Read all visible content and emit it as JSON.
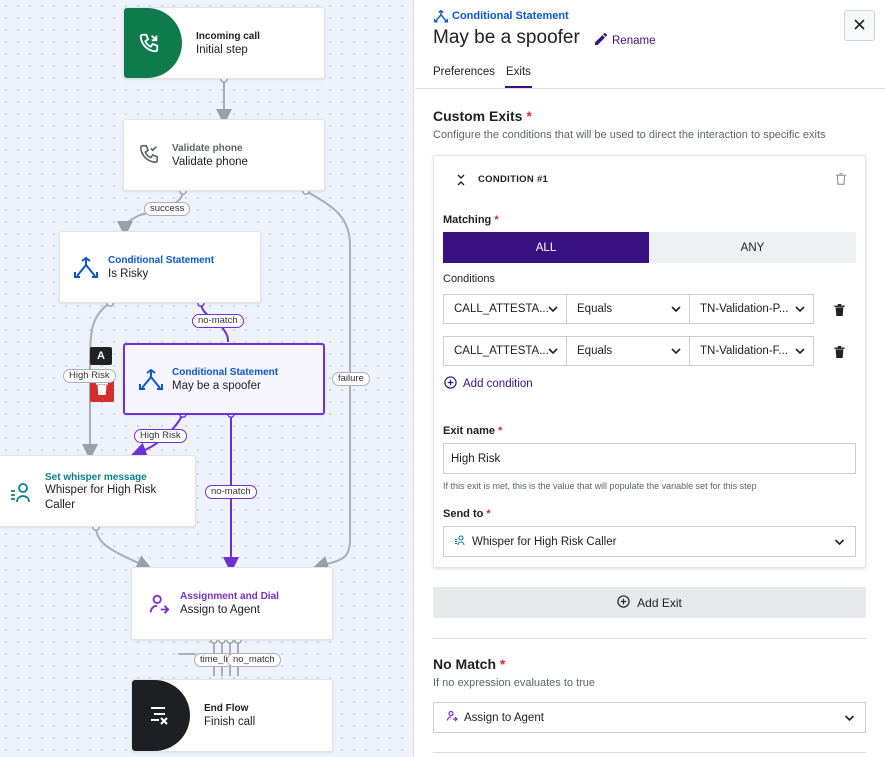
{
  "canvas": {
    "nodes": {
      "incoming": {
        "title": "Incoming call",
        "subtitle": "Initial step",
        "icon": "phone-incoming-icon"
      },
      "validate": {
        "title": "Validate phone",
        "subtitle": "Validate phone",
        "icon": "phone-check-icon"
      },
      "risky": {
        "title": "Conditional Statement",
        "subtitle": "Is Risky",
        "icon": "branch-icon"
      },
      "spoofer": {
        "title": "Conditional Statement",
        "subtitle": "May be a spoofer",
        "icon": "branch-icon"
      },
      "whisper": {
        "title": "Set whisper message",
        "subtitle_line1": "Whisper for High Risk",
        "subtitle_line2": "Caller",
        "icon": "whisper-icon"
      },
      "assign": {
        "title": "Assignment and Dial",
        "subtitle": "Assign to Agent",
        "icon": "agent-dial-icon"
      },
      "end": {
        "title": "End Flow",
        "subtitle": "Finish call",
        "icon": "end-flow-icon"
      }
    },
    "edge_labels": {
      "success": "success",
      "no_match_1": "no-match",
      "high_risk_1": "High Risk",
      "failure": "failure",
      "high_risk_2": "High Risk",
      "no_match_2": "no-match",
      "time_li": "time_li",
      "no_match_3": "no_match"
    },
    "node_toolbar": {
      "annotate_label": "A"
    }
  },
  "panel": {
    "kind": "Conditional Statement",
    "title": "May be a spoofer",
    "rename_label": "Rename",
    "tabs": [
      {
        "label": "Preferences",
        "active": false
      },
      {
        "label": "Exits",
        "active": true
      }
    ],
    "custom_exits": {
      "heading": "Custom Exits",
      "required_mark": "*",
      "description": "Configure the conditions that will be used to direct the interaction to specific exits"
    },
    "condition": {
      "label": "CONDITION #1",
      "matching_label": "Matching",
      "matching_options": [
        "ALL",
        "ANY"
      ],
      "matching_selected": "ALL",
      "conditions_label": "Conditions",
      "rows": [
        {
          "field": "CALL_ATTESTA...",
          "operator": "Equals",
          "value": "TN-Validation-P..."
        },
        {
          "field": "CALL_ATTESTA...",
          "operator": "Equals",
          "value": "TN-Validation-F..."
        }
      ],
      "add_condition_label": "Add condition",
      "exit_name_label": "Exit name",
      "exit_name_value": "High Risk",
      "exit_name_help": "If this exit is met, this is the value that will populate the variable set for this step",
      "send_to_label": "Send to",
      "send_to_value": "Whisper for High Risk Caller"
    },
    "add_exit_label": "Add Exit",
    "no_match": {
      "heading": "No Match",
      "description": "If no expression evaluates to true",
      "value": "Assign to Agent"
    }
  },
  "colors": {
    "accent": "#3a1180",
    "selected_border": "#6f2fd6",
    "blue_title": "#0b57d0",
    "teal_title": "#0a7f8c",
    "purple_title": "#7a2fc7",
    "green": "#0f7b4c",
    "delete_red": "#d32f2f"
  }
}
